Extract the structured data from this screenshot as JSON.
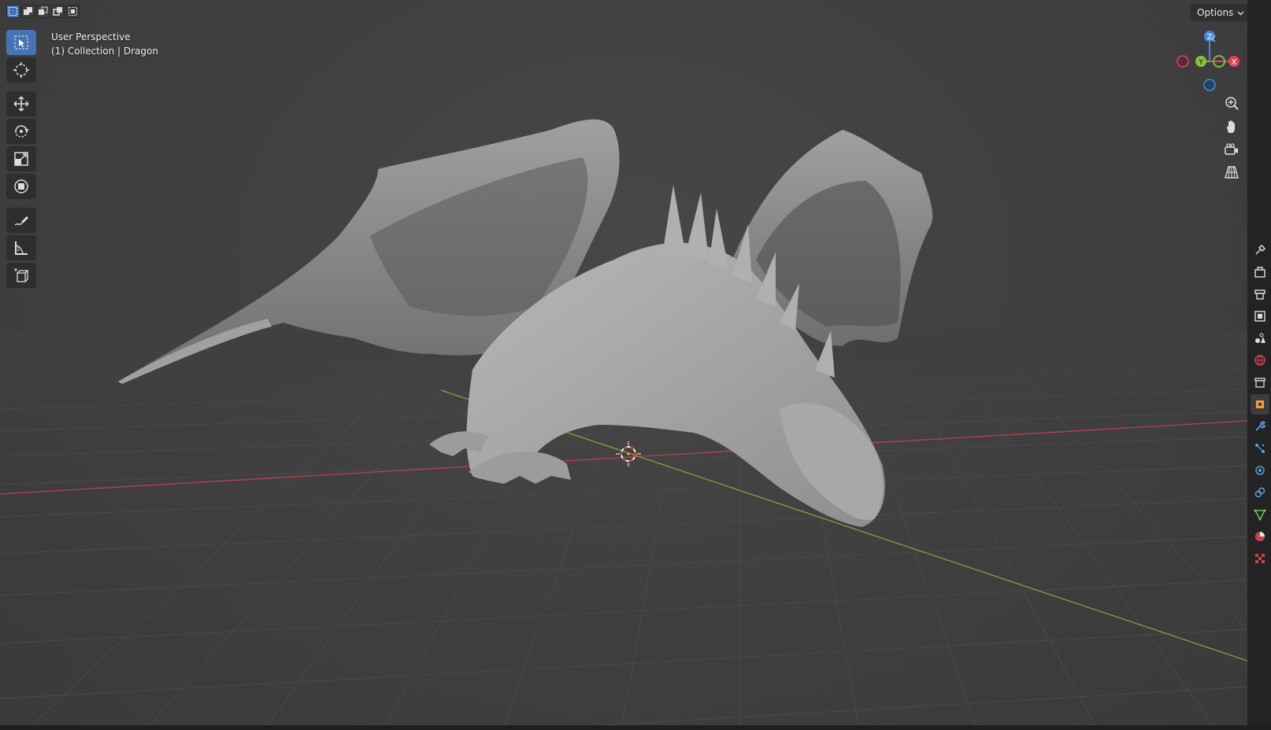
{
  "viewport": {
    "perspective_label": "User Perspective",
    "collection_label": "(1) Collection | Dragon",
    "object_name": "Dragon"
  },
  "header": {
    "options_label": "Options",
    "select_modes": [
      "set-new-selection",
      "extend-selection",
      "subtract-selection",
      "difference-selection",
      "intersect-selection"
    ]
  },
  "toolbar": {
    "tools": [
      "select-box",
      "cursor",
      "move",
      "rotate",
      "scale",
      "transform",
      "annotate",
      "measure",
      "add-cube"
    ],
    "active_tool": "select-box"
  },
  "gizmo": {
    "z_label": "Z",
    "y_label": "Y",
    "x_label": "X"
  },
  "navigation": [
    "zoom-icon",
    "pan-hand-icon",
    "camera-view-icon",
    "orthographic-grid-icon"
  ],
  "properties_tabs": [
    "tool",
    "render",
    "output",
    "view-layer",
    "scene",
    "world",
    "collection",
    "object",
    "modifiers",
    "particles",
    "physics",
    "constraints",
    "data",
    "material",
    "texture"
  ],
  "colors": {
    "accent": "#4772b3",
    "x_axis": "#e0435d",
    "y_axis": "#8ac23c",
    "z_axis": "#3f8ae0",
    "viewport_bg": "#404040"
  }
}
